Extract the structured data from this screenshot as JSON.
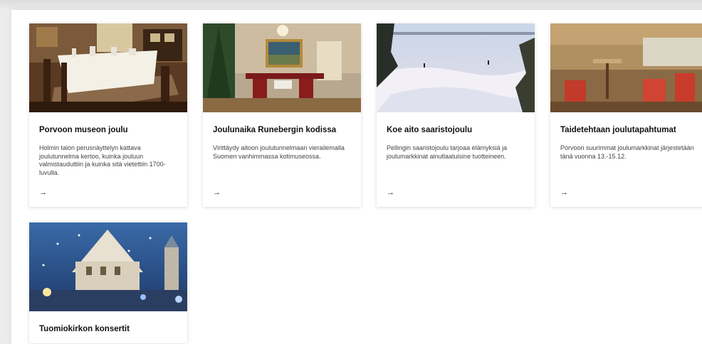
{
  "cards": [
    {
      "title": "Porvoon museon joulu",
      "description": "Holmin talon perusnäyttelyn kattava joulutunnelma kertoo, kuinka jouluun valmistauduttiin ja kuinka sitä vietettiin 1700-luvulla.",
      "arrow": "→",
      "image": "museum-dining-room"
    },
    {
      "title": "Joulunaika Runebergin kodissa",
      "description": "Virittäydy aitoon joulutunnelmaan vierailemalla Suomen vanhimmassa kotimuseossa.",
      "arrow": "→",
      "image": "runeberg-home-interior"
    },
    {
      "title": "Koe aito saaristojoulu",
      "description": "Pellingin saaristojoulu tarjoaa elämyksiä ja joulumarkkinat ainutlaatuisine tuotteineen.",
      "arrow": "→",
      "image": "snowy-archipelago"
    },
    {
      "title": "Taidetehtaan joulutapahtumat",
      "description": "Porvoon suurimmat joulumarkkinat järjestetään tänä vuonna 13.-15.12.",
      "arrow": "→",
      "image": "art-factory-cafe"
    },
    {
      "title": "Tuomiokirkon konsertit",
      "description": "",
      "arrow": "",
      "image": "cathedral-winter-night"
    }
  ]
}
